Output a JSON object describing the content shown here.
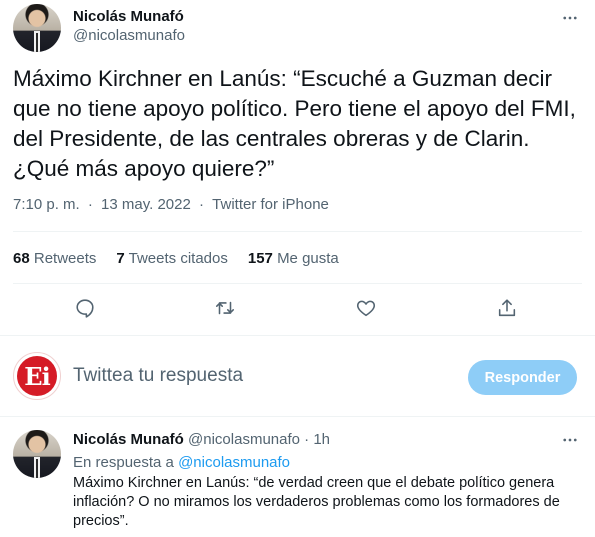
{
  "tweet": {
    "author_name": "Nicolás Munafó",
    "author_handle": "@nicolasmunafo",
    "text": "Máximo Kirchner en Lanús: “Escuché a Guzman decir que no tiene apoyo político. Pero tiene el apoyo del FMI, del Presidente, de las centrales obreras y de Clarin. ¿Qué más apoyo quiere?”",
    "time": "7:10 p. m.",
    "separator": "·",
    "date": "13 may. 2022",
    "source": "Twitter for iPhone"
  },
  "stats": {
    "retweets_count": "68",
    "retweets_label": "Retweets",
    "quotes_count": "7",
    "quotes_label": "Tweets citados",
    "likes_count": "157",
    "likes_label": "Me gusta"
  },
  "actions": {
    "icons": [
      "reply-icon",
      "retweet-icon",
      "like-icon",
      "share-icon"
    ]
  },
  "composer": {
    "avatar_text": "Ei",
    "placeholder": "Twittea tu respuesta",
    "button_label": "Responder",
    "button_color": "#8ecdf7",
    "avatar_color": "#d51b26"
  },
  "reply": {
    "author_name": "Nicolás Munafó",
    "author_handle": "@nicolasmunafo",
    "separator": "·",
    "age": "1h",
    "in_reply_prefix": "En respuesta a",
    "in_reply_handle": "@nicolasmunafo",
    "text": "Máximo Kirchner en Lanús: “de verdad creen que el debate político genera inflación? O no miramos los verdaderos problemas como los formadores de precios”."
  },
  "colors": {
    "text": "#0f1419",
    "secondary": "#536471",
    "link": "#1d9bf0",
    "divider": "#eff3f4"
  }
}
